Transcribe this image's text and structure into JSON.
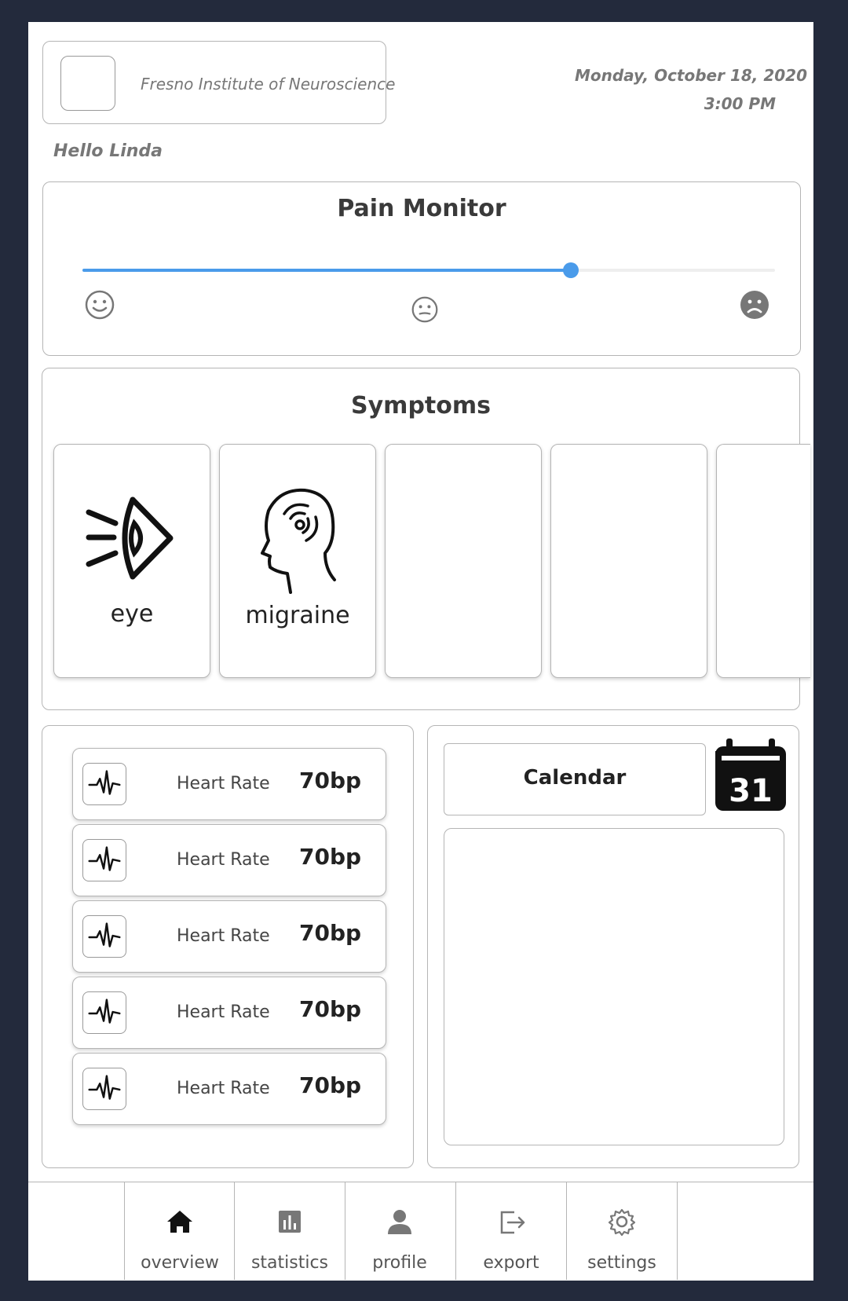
{
  "header": {
    "institution": "Fresno Institute of Neuroscience",
    "date": "Monday, October 18, 2020",
    "time": "3:00 PM",
    "greeting": "Hello Linda"
  },
  "pain_monitor": {
    "title": "Pain Monitor",
    "level": 0.705,
    "accent": "#4a9bea",
    "faces": [
      "smile-icon",
      "neutral-icon",
      "sad-icon"
    ]
  },
  "symptoms": {
    "title": "Symptoms",
    "items": [
      {
        "label": "eye",
        "icon": "eye-icon"
      },
      {
        "label": "migraine",
        "icon": "migraine-head-icon"
      },
      {
        "label": "",
        "icon": ""
      },
      {
        "label": "",
        "icon": ""
      },
      {
        "label": "",
        "icon": ""
      }
    ]
  },
  "vitals": [
    {
      "label": "Heart Rate",
      "value": "70bp",
      "icon": "heartbeat-icon"
    },
    {
      "label": "Heart Rate",
      "value": "70bp",
      "icon": "heartbeat-icon"
    },
    {
      "label": "Heart Rate",
      "value": "70bp",
      "icon": "heartbeat-icon"
    },
    {
      "label": "Heart Rate",
      "value": "70bp",
      "icon": "heartbeat-icon"
    },
    {
      "label": "Heart Rate",
      "value": "70bp",
      "icon": "heartbeat-icon"
    }
  ],
  "calendar": {
    "button_label": "Calendar",
    "icon_day": "31"
  },
  "nav": [
    {
      "label": "overview",
      "icon": "home-icon"
    },
    {
      "label": "statistics",
      "icon": "bar-chart-icon"
    },
    {
      "label": "profile",
      "icon": "user-icon"
    },
    {
      "label": "export",
      "icon": "export-icon"
    },
    {
      "label": "settings",
      "icon": "gear-icon"
    }
  ]
}
